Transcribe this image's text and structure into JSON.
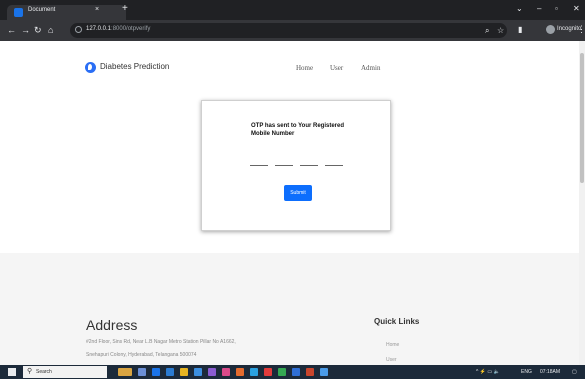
{
  "browser": {
    "tab_title": "Document",
    "tab_close": "×",
    "new_tab": "+",
    "url_host": "127.0.0.1",
    "url_path": ":8000/otpverify",
    "profile": "Incognito",
    "icons": [
      "back-icon",
      "forward-icon",
      "reload-icon",
      "home-icon",
      "zoom-icon",
      "star-icon",
      "sidebar-icon",
      "incognito-icon",
      "kebab-menu-icon"
    ]
  },
  "site": {
    "brand": "Diabetes Prediction",
    "nav": [
      "Home",
      "User",
      "Admin"
    ]
  },
  "otp": {
    "message": "OTP has sent to Your Registered Mobile Number",
    "submit_label": "Submit",
    "digit_count": 4
  },
  "footer": {
    "address_title": "Address",
    "address_line1": "#2nd Floor, Sins Rd, Near L.B Nagar Metro Station Pillar No A1662,",
    "address_line2": "Snehapuri Colony, Hyderabad, Telangana 500074",
    "quick_links_title": "Quick Links",
    "quick_links": [
      "Home",
      "User"
    ]
  },
  "taskbar": {
    "search_label": "Search",
    "tray_lang": "ENG",
    "tray_time": "07:18AM"
  },
  "colors": {
    "brand_blue": "#2a6ef5",
    "submit_blue": "#0d6efd",
    "chrome_dark": "#202124",
    "footer_bg": "#f5f5f5"
  }
}
